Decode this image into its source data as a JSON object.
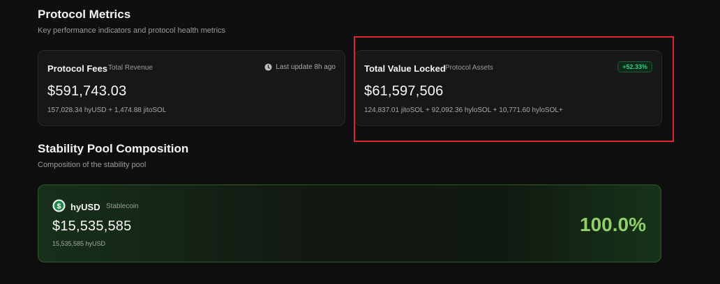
{
  "protocol_metrics": {
    "title": "Protocol Metrics",
    "subtitle": "Key performance indicators and protocol health metrics"
  },
  "fees_card": {
    "title": "Protocol Fees",
    "tag": "Total Revenue",
    "update": "Last update 8h ago",
    "value": "$591,743.03",
    "detail": "157,028.34 hyUSD + 1,474.88 jitoSOL"
  },
  "tvl_card": {
    "title": "Total Value Locked",
    "tag": "Protocol Assets",
    "badge": "+52.33%",
    "value": "$61,597,506",
    "detail": "124,837.01 jitoSOL + 92,092.36 hyloSOL + 10,771.60 hyloSOL+"
  },
  "stability_pool": {
    "title": "Stability Pool Composition",
    "subtitle": "Composition of the stability pool",
    "token": {
      "name": "hyUSD",
      "type": "Stablecoin",
      "value": "$15,535,585",
      "detail": "15,535,585 hyUSD",
      "percentage": "100.0%"
    }
  },
  "colors": {
    "background": "#0f0f0f",
    "badge_green": "#35d07f",
    "percentage_green": "#8fcf6a",
    "highlight_red": "#e0252a"
  },
  "icons": {
    "clock": "clock-icon",
    "token": "hyusd-token-icon"
  }
}
